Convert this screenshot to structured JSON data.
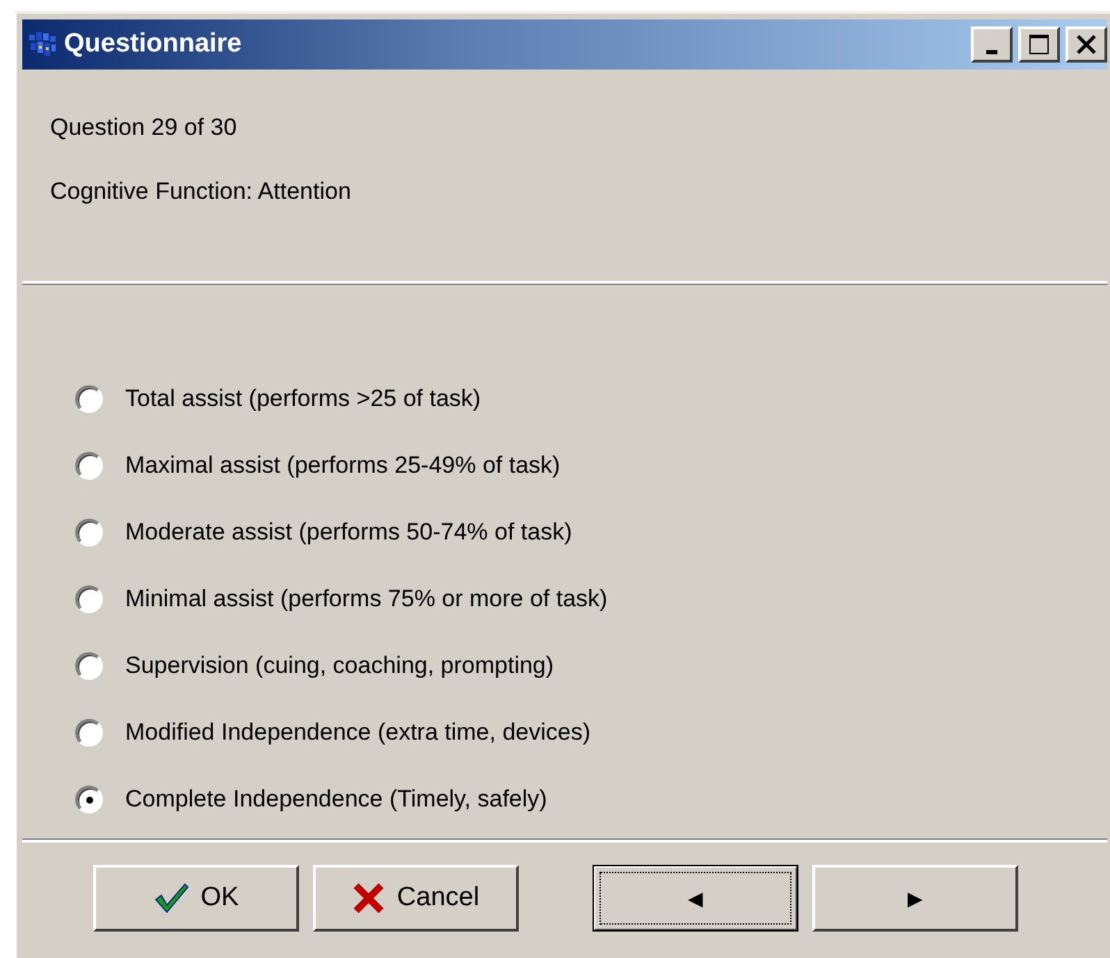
{
  "window": {
    "title": "Questionnaire"
  },
  "header": {
    "question_number": "Question 29 of 30",
    "category": "Cognitive Function: Attention"
  },
  "options": [
    {
      "label": "Total assist (performs >25 of task)",
      "selected": false
    },
    {
      "label": "Maximal assist (performs 25-49% of task)",
      "selected": false
    },
    {
      "label": "Moderate assist (performs 50-74% of  task)",
      "selected": false
    },
    {
      "label": "Minimal assist (performs 75% or more of task)",
      "selected": false
    },
    {
      "label": "Supervision (cuing, coaching, prompting)",
      "selected": false
    },
    {
      "label": "Modified Independence (extra time, devices)",
      "selected": false
    },
    {
      "label": "Complete Independence (Timely, safely)",
      "selected": true
    }
  ],
  "buttons": [
    {
      "kind": "ok",
      "label": "OK",
      "focused": false
    },
    {
      "kind": "cancel",
      "label": "Cancel",
      "focused": false
    },
    {
      "kind": "previous",
      "label": "◀",
      "focused": true
    },
    {
      "kind": "next",
      "label": "▶",
      "focused": false
    }
  ]
}
